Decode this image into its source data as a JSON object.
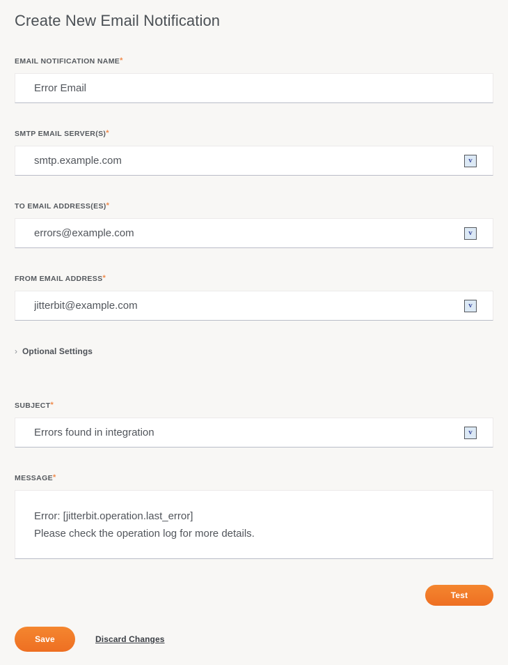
{
  "page": {
    "title": "Create New Email Notification",
    "required_marker": "*",
    "accent_color": "#ee7d2d",
    "background_color": "#f8f7f5",
    "text_color": "#51555b"
  },
  "fields": [
    {
      "label": "EMAIL NOTIFICATION NAME",
      "required": true,
      "value": "Error Email",
      "has_dropdown": false
    },
    {
      "label": "SMTP EMAIL SERVER(S)",
      "required": true,
      "value": "smtp.example.com",
      "has_dropdown": true
    },
    {
      "label": "TO EMAIL ADDRESS(ES)",
      "required": true,
      "value": "errors@example.com",
      "has_dropdown": true
    },
    {
      "label": "FROM EMAIL ADDRESS",
      "required": true,
      "value": "jitterbit@example.com",
      "has_dropdown": true
    },
    {
      "label": "SUBJECT",
      "required": true,
      "value": "Errors found in integration",
      "has_dropdown": true
    },
    {
      "label": "MESSAGE",
      "required": true,
      "value_line1": "Error: [jitterbit.operation.last_error]",
      "value_line2": "Please check the operation log for more details.",
      "has_dropdown": false
    }
  ],
  "optional_settings": {
    "label": "Optional Settings",
    "icon": "chevron-right-icon",
    "expanded": false
  },
  "dropdown_icon": {
    "name": "chevron-down-icon",
    "glyph": "v"
  },
  "actions": {
    "test_label": "Test",
    "save_label": "Save",
    "discard_label": "Discard Changes"
  }
}
